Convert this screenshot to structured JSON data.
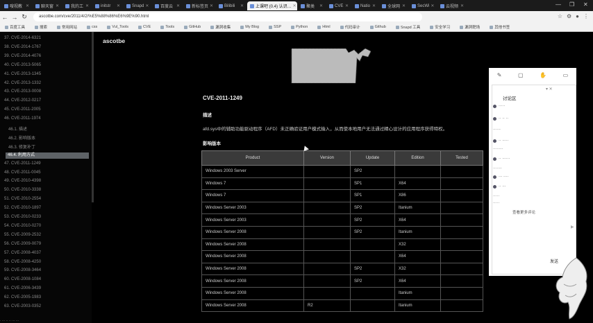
{
  "tabs": [
    {
      "label": "嗖视教",
      "active": false
    },
    {
      "label": "聊天窗",
      "active": false
    },
    {
      "label": "我的工",
      "active": false
    },
    {
      "label": "initstr",
      "active": false
    },
    {
      "label": "Snapd",
      "active": false
    },
    {
      "label": "百度云",
      "active": false
    },
    {
      "label": "新标签页",
      "active": false
    },
    {
      "label": "Bilibili",
      "active": false
    },
    {
      "label": "上课吧 (0.4) 认识…",
      "active": true
    },
    {
      "label": "聚类",
      "active": false
    },
    {
      "label": "CVE",
      "active": false
    },
    {
      "label": "Natio",
      "active": false
    },
    {
      "label": "全球网",
      "active": false
    },
    {
      "label": "SecWi",
      "active": false
    },
    {
      "label": "云视频",
      "active": false
    }
  ],
  "window_controls": [
    "—",
    "❐",
    "✕"
  ],
  "address": {
    "url": "ascotbe.com/cve/2011/4/2/%E5%88%86%E6%9E%90.html"
  },
  "bookmarks": [
    "百度工具",
    "搜索",
    "常用网站",
    "css",
    "Vul_Tools",
    "CVE",
    "Tools",
    "GitHub",
    "漏洞收集",
    "My Blog",
    "SSP",
    "Python",
    "Html",
    "代码审计",
    "Github",
    "Snapd 工具",
    "安全学习",
    "漏洞靶场",
    "其他书签"
  ],
  "sidebar": {
    "items": [
      {
        "label": "37. CVE-2014-6321",
        "sub": false,
        "active": false
      },
      {
        "label": "38. CVE-2014-1767",
        "sub": false,
        "active": false
      },
      {
        "label": "39. CVE-2014-4076",
        "sub": false,
        "active": false
      },
      {
        "label": "40. CVE-2013-5065",
        "sub": false,
        "active": false
      },
      {
        "label": "41. CVE-2013-1345",
        "sub": false,
        "active": false
      },
      {
        "label": "42. CVE-2013-1332",
        "sub": false,
        "active": false
      },
      {
        "label": "43. CVE-2013-0008",
        "sub": false,
        "active": false
      },
      {
        "label": "44. CVE-2012-0217",
        "sub": false,
        "active": false
      },
      {
        "label": "45. CVE-2011-2005",
        "sub": false,
        "active": false
      },
      {
        "label": "46. CVE-2011-1974",
        "sub": false,
        "active": false
      },
      {
        "label": "46.1. 描述",
        "sub": true,
        "active": false
      },
      {
        "label": "46.2. 影响版本",
        "sub": true,
        "active": false
      },
      {
        "label": "46.3. 修复补丁",
        "sub": true,
        "active": false
      },
      {
        "label": "46.4. 利用方式",
        "sub": true,
        "active": true
      },
      {
        "label": "47. CVE-2011-1249",
        "sub": false,
        "active": false
      },
      {
        "label": "48. CVE-2011-0045",
        "sub": false,
        "active": false
      },
      {
        "label": "49. CVE-2010-4398",
        "sub": false,
        "active": false
      },
      {
        "label": "50. CVE-2010-3338",
        "sub": false,
        "active": false
      },
      {
        "label": "51. CVE-2010-2554",
        "sub": false,
        "active": false
      },
      {
        "label": "52. CVE-2010-1897",
        "sub": false,
        "active": false
      },
      {
        "label": "53. CVE-2010-0233",
        "sub": false,
        "active": false
      },
      {
        "label": "54. CVE-2010-0270",
        "sub": false,
        "active": false
      },
      {
        "label": "55. CVE-2009-2532",
        "sub": false,
        "active": false
      },
      {
        "label": "56. CVE-2009-0079",
        "sub": false,
        "active": false
      },
      {
        "label": "57. CVE-2008-4037",
        "sub": false,
        "active": false
      },
      {
        "label": "58. CVE-2008-4250",
        "sub": false,
        "active": false
      },
      {
        "label": "59. CVE-2008-3464",
        "sub": false,
        "active": false
      },
      {
        "label": "60. CVE-2008-1084",
        "sub": false,
        "active": false
      },
      {
        "label": "61. CVE-2006-3439",
        "sub": false,
        "active": false
      },
      {
        "label": "62. CVE-2005-1983",
        "sub": false,
        "active": false
      },
      {
        "label": "63. CVE-2003-0352",
        "sub": false,
        "active": false
      }
    ]
  },
  "main": {
    "site_title": "ascotbe",
    "cve_title": "CVE-2011-1249",
    "desc_heading": "描述",
    "desc_text": "afd.sys中的辅助功能驱动程序（AFD）未正确验证用户模式输入，从而使本地用户无法通过精心设计的应用程序获得特权。",
    "affected_heading": "影响版本",
    "table": {
      "headers": [
        "Product",
        "Version",
        "Update",
        "Edition",
        "Tested"
      ],
      "rows": [
        [
          "Windows 2003 Server",
          "",
          "SP2",
          "",
          ""
        ],
        [
          "Windows 7",
          "",
          "SP1",
          "X64",
          ""
        ],
        [
          "Windows 7",
          "",
          "SP1",
          "X86",
          ""
        ],
        [
          "Windows Server 2003",
          "",
          "SP2",
          "Itanium",
          ""
        ],
        [
          "Windows Server 2003",
          "",
          "SP2",
          "X64",
          ""
        ],
        [
          "Windows Server 2008",
          "",
          "SP2",
          "Itanium",
          ""
        ],
        [
          "Windows Server 2008",
          "",
          "",
          "X32",
          ""
        ],
        [
          "Windows Server 2008",
          "",
          "",
          "X64",
          ""
        ],
        [
          "Windows Server 2008",
          "",
          "SP2",
          "X32",
          ""
        ],
        [
          "Windows Server 2008",
          "",
          "SP2",
          "X64",
          ""
        ],
        [
          "Windows Server 2008",
          "",
          "",
          "Itanium",
          ""
        ],
        [
          "Windows Server 2008",
          "R2",
          "",
          "Itanium",
          ""
        ]
      ]
    }
  },
  "panel": {
    "title": "讨论区",
    "link_text": "查看更多评论",
    "button": "发送"
  }
}
